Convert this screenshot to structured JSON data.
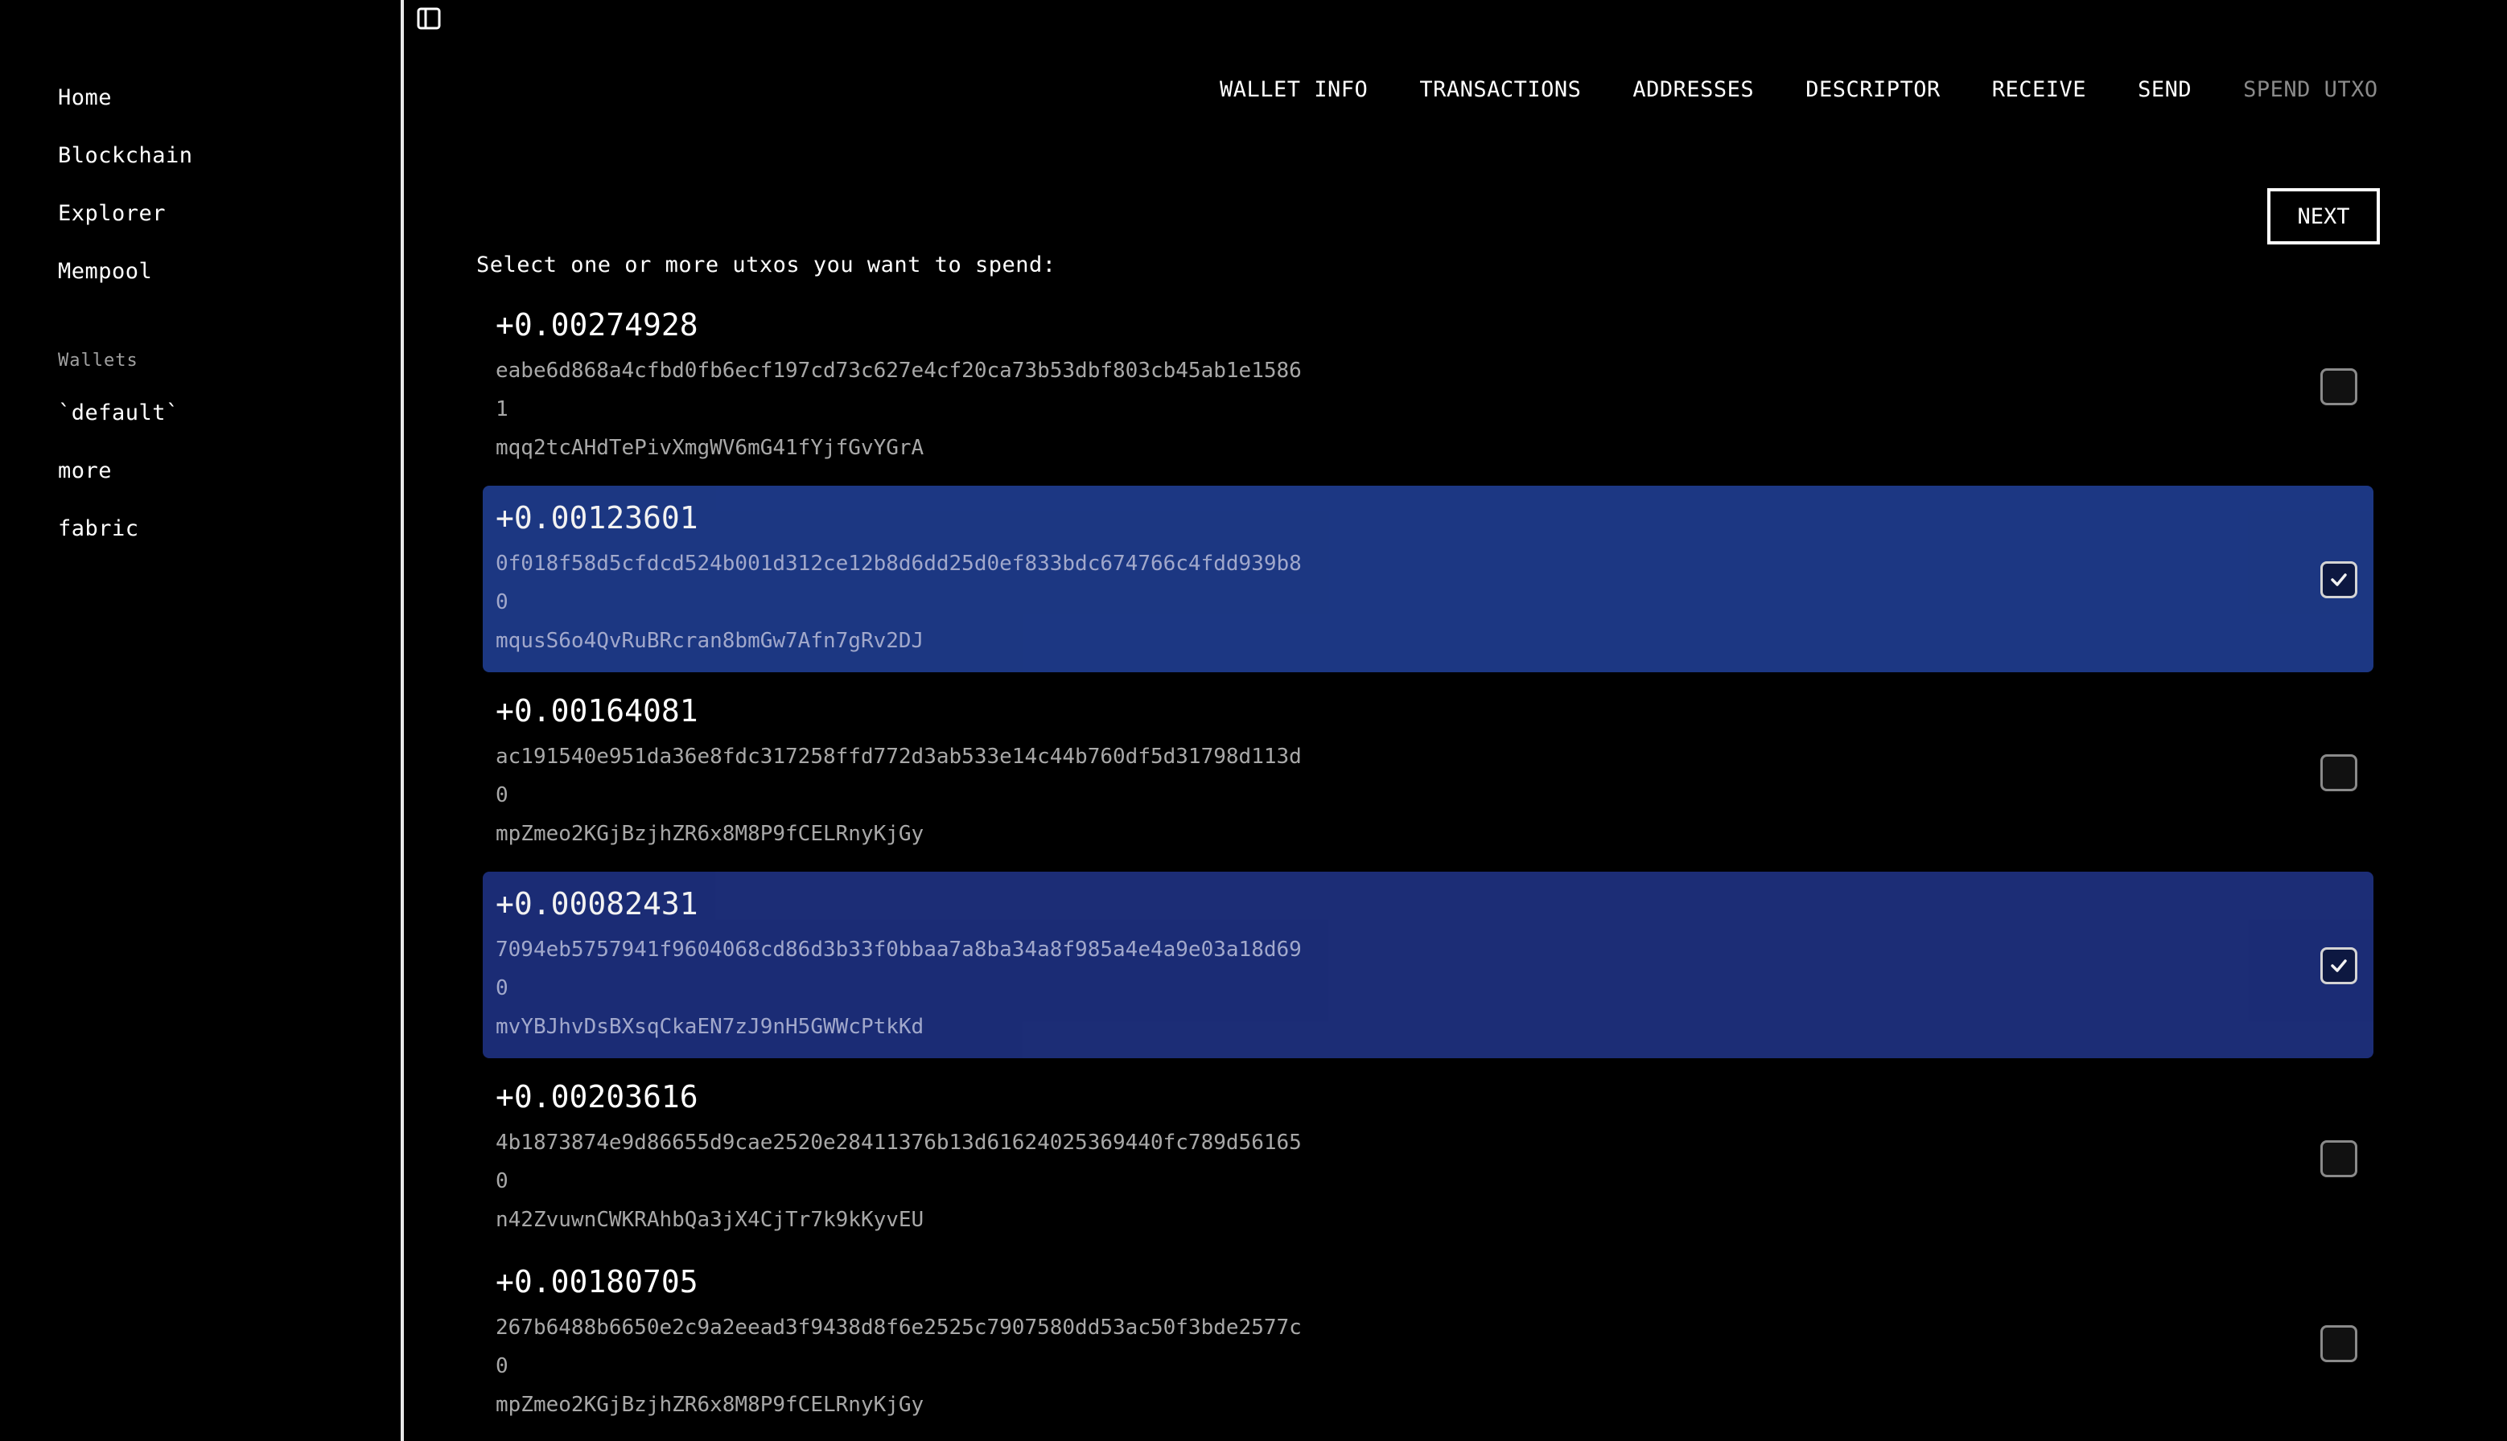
{
  "sidebar": {
    "nav": [
      {
        "label": "Home"
      },
      {
        "label": "Blockchain"
      },
      {
        "label": "Explorer"
      },
      {
        "label": "Mempool"
      }
    ],
    "wallets_label": "Wallets",
    "wallets": [
      {
        "label": "`default`"
      },
      {
        "label": "more"
      },
      {
        "label": "fabric"
      }
    ]
  },
  "topnav": {
    "tabs": [
      {
        "label": "WALLET INFO"
      },
      {
        "label": "TRANSACTIONS"
      },
      {
        "label": "ADDRESSES"
      },
      {
        "label": "DESCRIPTOR"
      },
      {
        "label": "RECEIVE"
      },
      {
        "label": "SEND"
      },
      {
        "label": "SPEND UTXO"
      }
    ]
  },
  "main": {
    "next_label": "NEXT",
    "instruction": "Select one or more utxos you want to spend:",
    "utxos": [
      {
        "amount": "+0.00274928",
        "txid": "eabe6d868a4cfbd0fb6ecf197cd73c627e4cf20ca73b53dbf803cb45ab1e1586",
        "vout": "1",
        "address": "mqq2tcAHdTePivXmgWV6mG41fYjfGvYGrA",
        "selected": false
      },
      {
        "amount": "+0.00123601",
        "txid": "0f018f58d5cfdcd524b001d312ce12b8d6dd25d0ef833bdc674766c4fdd939b8",
        "vout": "0",
        "address": "mqusS6o4QvRuBRcran8bmGw7Afn7gRv2DJ",
        "selected": true
      },
      {
        "amount": "+0.00164081",
        "txid": "ac191540e951da36e8fdc317258ffd772d3ab533e14c44b760df5d31798d113d",
        "vout": "0",
        "address": "mpZmeo2KGjBzjhZR6x8M8P9fCELRnyKjGy",
        "selected": false
      },
      {
        "amount": "+0.00082431",
        "txid": "7094eb5757941f9604068cd86d3b33f0bbaa7a8ba34a8f985a4e4a9e03a18d69",
        "vout": "0",
        "address": "mvYBJhvDsBXsqCkaEN7zJ9nH5GWWcPtkKd",
        "selected": true
      },
      {
        "amount": "+0.00203616",
        "txid": "4b1873874e9d86655d9cae2520e28411376b13d61624025369440fc789d56165",
        "vout": "0",
        "address": "n42ZvuwnCWKRAhbQa3jX4CjTr7k9kKyvEU",
        "selected": false
      },
      {
        "amount": "+0.00180705",
        "txid": "267b6488b6650e2c9a2eead3f9438d8f6e2525c7907580dd53ac50f3bde2577c",
        "vout": "0",
        "address": "mpZmeo2KGjBzjhZR6x8M8P9fCELRnyKjGy",
        "selected": false
      }
    ]
  }
}
